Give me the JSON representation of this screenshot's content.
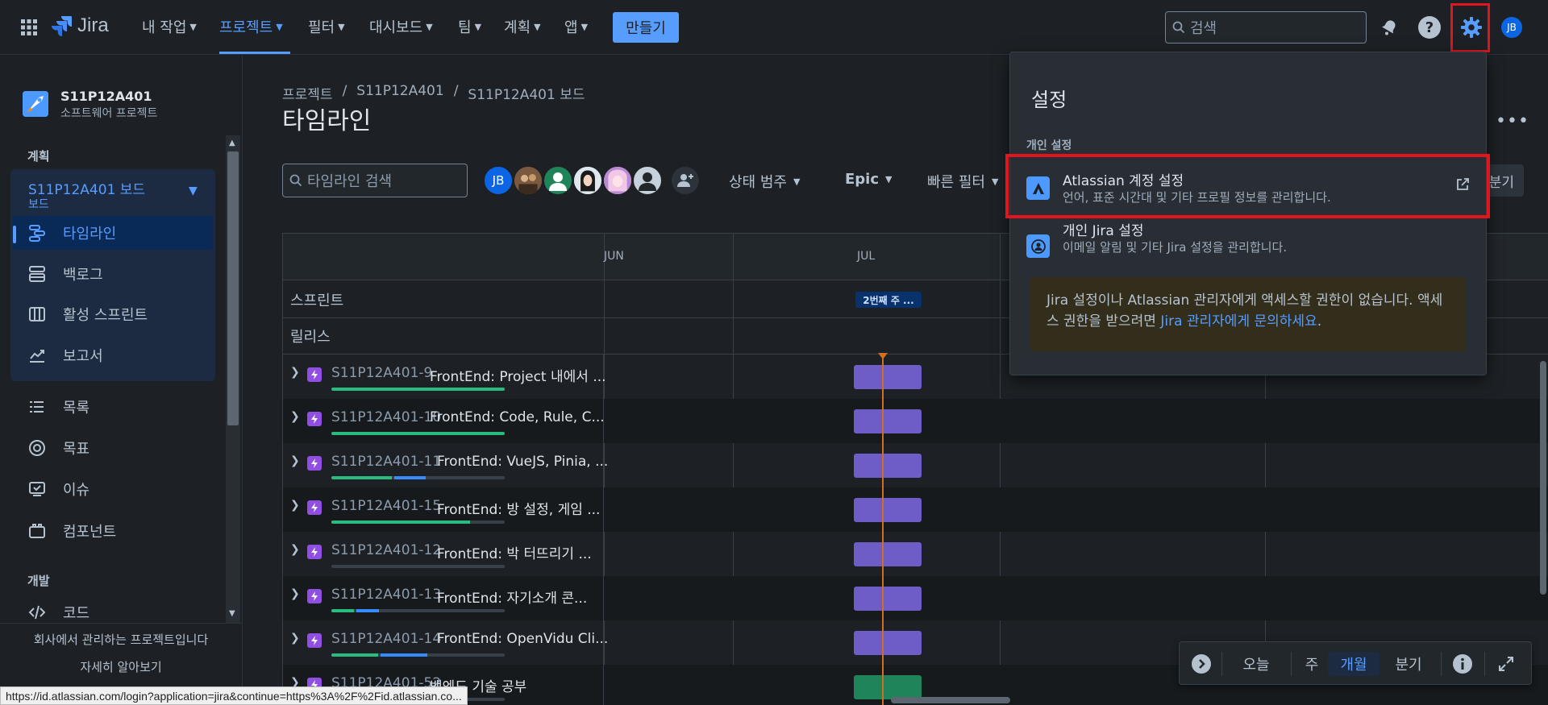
{
  "topnav": {
    "app_name": "Jira",
    "items": [
      {
        "label": "내 작업"
      },
      {
        "label": "프로젝트"
      },
      {
        "label": "필터"
      },
      {
        "label": "대시보드"
      },
      {
        "label": "팀"
      },
      {
        "label": "계획"
      },
      {
        "label": "앱"
      }
    ],
    "create_label": "만들기",
    "search_placeholder": "검색",
    "avatar_initials": "JB"
  },
  "sidebar": {
    "project_name": "S11P12A401",
    "project_type": "소프트웨어 프로젝트",
    "plan_heading": "계획",
    "board_title": "S11P12A401 보드",
    "board_sub": "보드",
    "board_items": [
      {
        "label": "타임라인",
        "icon": "timeline-icon"
      },
      {
        "label": "백로그",
        "icon": "backlog-icon"
      },
      {
        "label": "활성 스프린트",
        "icon": "board-icon"
      },
      {
        "label": "보고서",
        "icon": "reports-icon"
      }
    ],
    "items": [
      {
        "label": "목록",
        "icon": "list-icon"
      },
      {
        "label": "목표",
        "icon": "goal-icon"
      },
      {
        "label": "이슈",
        "icon": "issues-icon"
      },
      {
        "label": "컴포넌트",
        "icon": "components-icon"
      }
    ],
    "dev_heading": "개발",
    "code_label": "코드",
    "footer_text": "회사에서 관리하는 프로젝트입니다",
    "learn_more": "자세히 알아보기"
  },
  "main": {
    "breadcrumb": [
      "프로젝트",
      "/",
      "S11P12A401",
      "/",
      "S11P12A401 보드"
    ],
    "title": "타임라인",
    "search_placeholder": "타임라인 검색",
    "avatar_initials": "JB",
    "filters": {
      "status_category": "상태 범주",
      "epic": "Epic",
      "quick_filter": "빠른 필터",
      "quarter_partial": "분기"
    }
  },
  "timeline": {
    "months": [
      "JUN",
      "JUL"
    ],
    "sprint_row_label": "스프린트",
    "release_row_label": "릴리스",
    "sprint_pill": "2번째 주 ...",
    "issues": [
      {
        "key": "S11P12A401-9",
        "summary": "FrontEnd: Project 내에서 ...",
        "done": 1.0,
        "in_progress": 0.0,
        "bar": "purple"
      },
      {
        "key": "S11P12A401-10",
        "summary": "FrontEnd: Code, Rule, C...",
        "done": 1.0,
        "in_progress": 0.0,
        "bar": "purple"
      },
      {
        "key": "S11P12A401-11",
        "summary": "FrontEnd: VueJS, Pinia, ...",
        "done": 0.35,
        "in_progress": 0.18,
        "bar": "purple"
      },
      {
        "key": "S11P12A401-15",
        "summary": "FrontEnd: 방 설정, 게임 ...",
        "done": 0.8,
        "in_progress": 0.0,
        "bar": "purple"
      },
      {
        "key": "S11P12A401-12",
        "summary": "FrontEnd: 박 터뜨리기 ...",
        "done": 0.0,
        "in_progress": 0.0,
        "bar": "purple"
      },
      {
        "key": "S11P12A401-13",
        "summary": "FrontEnd: 자기소개 콘...",
        "done": 0.13,
        "in_progress": 0.13,
        "bar": "purple"
      },
      {
        "key": "S11P12A401-14",
        "summary": "FrontEnd: OpenVidu Cli...",
        "done": 0.27,
        "in_progress": 0.27,
        "bar": "purple"
      },
      {
        "key": "S11P12A401-52",
        "summary": "백엔드 기술 공부",
        "done": 0.0,
        "in_progress": 0.0,
        "bar": "green"
      }
    ]
  },
  "zoom_bar": {
    "today": "오늘",
    "week": "주",
    "month": "개월",
    "quarter": "분기"
  },
  "settings_panel": {
    "title": "설정",
    "personal_heading": "개인 설정",
    "atlassian_title": "Atlassian 계정 설정",
    "atlassian_desc": "언어, 표준 시간대 및 기타 프로필 정보를 관리합니다.",
    "jira_title": "개인 Jira 설정",
    "jira_desc": "이메일 알림 및 기타 Jira 설정을 관리합니다.",
    "notice_text": "Jira 설정이나 Atlassian 관리자에게 액세스할 권한이 없습니다. 액세스 권한을 받으려면 ",
    "notice_link": "Jira 관리자에게 문의하세요",
    "notice_end": "."
  },
  "status_url": "https://id.atlassian.com/login?application=jira&continue=https%3A%2F%2Fid.atlassian.co...",
  "colors": {
    "accent": "#579dff",
    "epic": "#904ee2",
    "bar_purple": "#6e5dc6",
    "bar_green": "#1f845a",
    "today_line": "#d26e1f",
    "highlight": "#e4141e"
  }
}
